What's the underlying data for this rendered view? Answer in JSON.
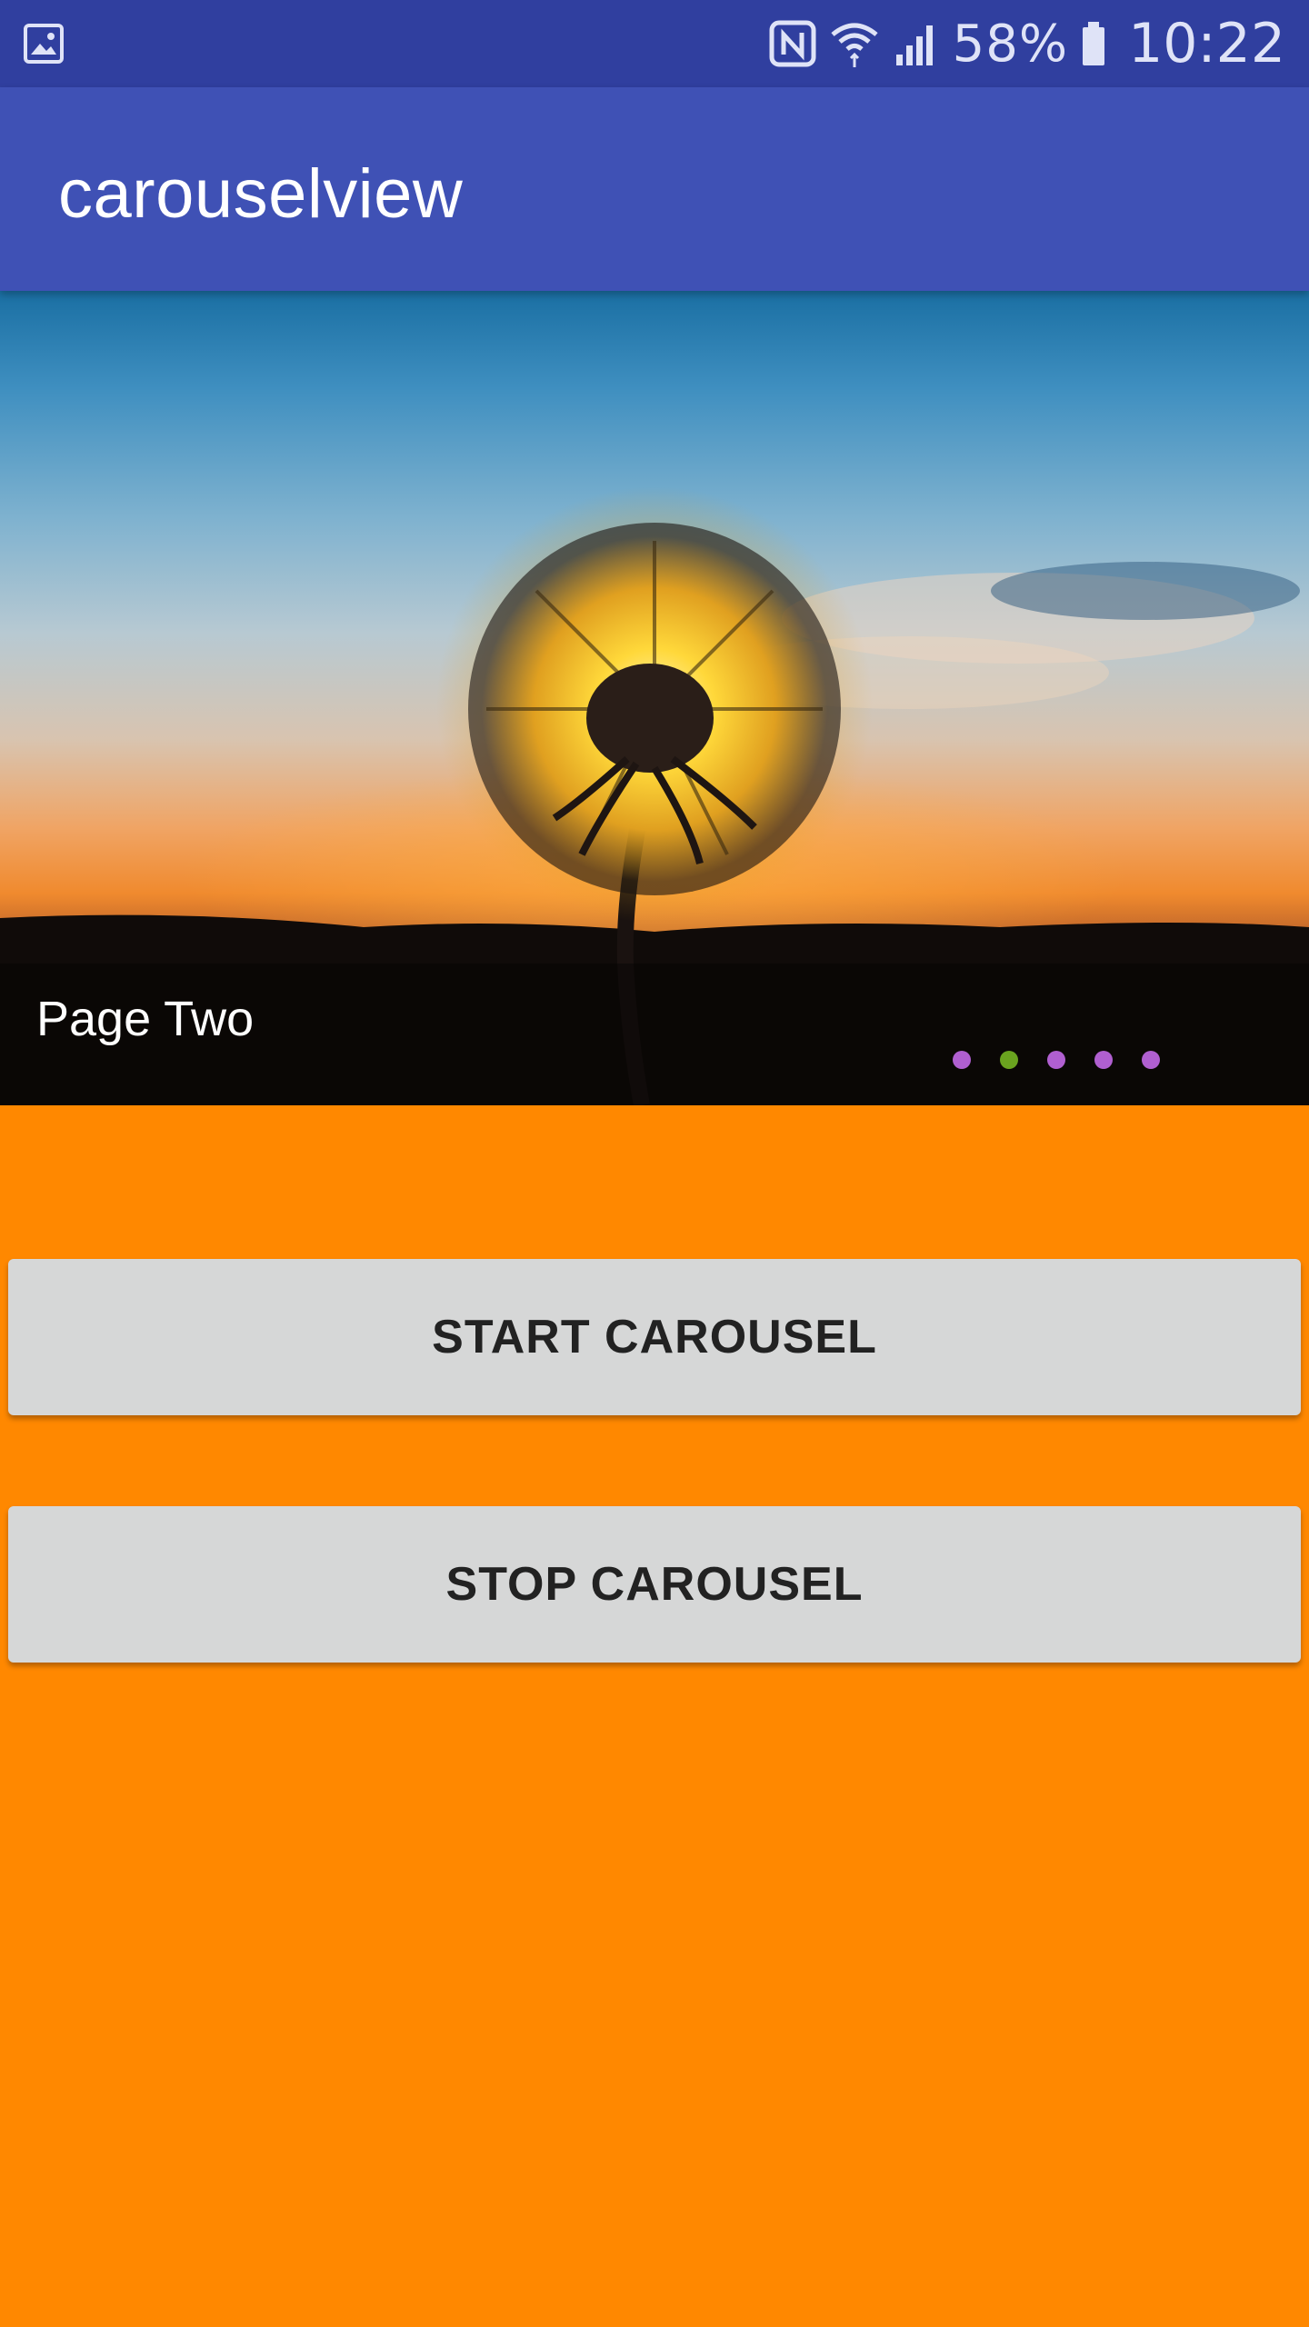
{
  "status_bar": {
    "icons": [
      "gallery-icon",
      "nfc-icon",
      "wifi-icon",
      "cellular-signal-icon",
      "battery-icon"
    ],
    "battery_percent": "58%",
    "time": "10:22",
    "background_color": "#303f9f"
  },
  "app_bar": {
    "title": "carouselview",
    "background_color": "#3f51b5"
  },
  "carousel": {
    "page_label": "Page Two",
    "page_count": 5,
    "active_index": 1,
    "indicator_color": "#b05fd0",
    "active_indicator_color": "#6aa31f"
  },
  "buttons": {
    "start_label": "START CAROUSEL",
    "stop_label": "STOP CAROUSEL"
  },
  "page_background": "#ff8800"
}
